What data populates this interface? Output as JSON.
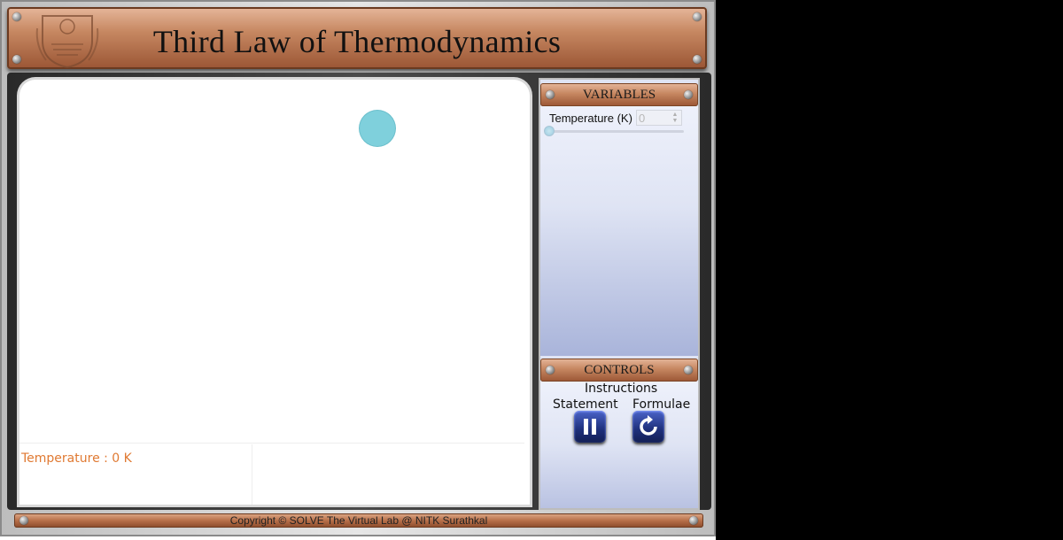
{
  "app": {
    "title": "Third Law of Thermodynamics",
    "logo_icon": "nitk-crest-icon"
  },
  "simulation": {
    "readout": "Temperature : 0 K",
    "particle_color": "#7fd0dc"
  },
  "variables_panel": {
    "title": "VARIABLES",
    "temperature_label": "Temperature (K)",
    "temperature_value": "0",
    "temperature_slider_fraction": 0
  },
  "controls_panel": {
    "title": "CONTROLS",
    "instructions_label": "Instructions",
    "statement_label": "Statement",
    "formulae_label": "Formulae",
    "pause_icon": "pause-icon",
    "reset_icon": "reset-icon"
  },
  "footer": {
    "copyright": "Copyright © SOLVE The Virtual Lab @ NITK Surathkal"
  },
  "colors": {
    "copper": "#c68761",
    "readout_text": "#e07a33",
    "button_blue": "#1e2f7a"
  }
}
